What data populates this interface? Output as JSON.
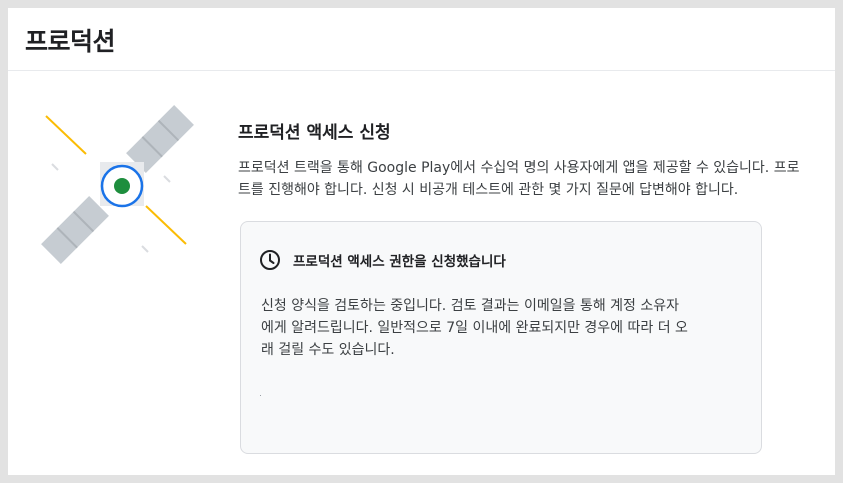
{
  "page": {
    "title": "프로덕션"
  },
  "section": {
    "heading": "프로덕션 액세스 신청",
    "description_lines": [
      "프로덕션 트랙을 통해 Google Play에서 수십억 명의 사용자에게 앱을 제공할 수 있습니다. 프로",
      "트를 진행해야 합니다. 신청 시 비공개 테스트에 관한 몇 가지 질문에 답변해야 합니다."
    ]
  },
  "status_card": {
    "icon": "clock-icon",
    "title": "프로덕션 액세스 권한을 신청했습니다",
    "body_lines": [
      "신청 양식을 검토하는 중입니다. 검토 결과는 이메일을 통해 계정 소유자",
      "에게 알려드립니다. 일반적으로 7일 이내에 완료되지만 경우에 따라 더 오",
      "래 걸릴 수도 있습니다."
    ]
  },
  "illustration": {
    "icon": "satellite-icon"
  },
  "colors": {
    "accent_blue": "#1a73e8",
    "accent_green": "#1e8e3e",
    "accent_yellow": "#fbbc04",
    "panel_gray": "#c6ccd2"
  }
}
